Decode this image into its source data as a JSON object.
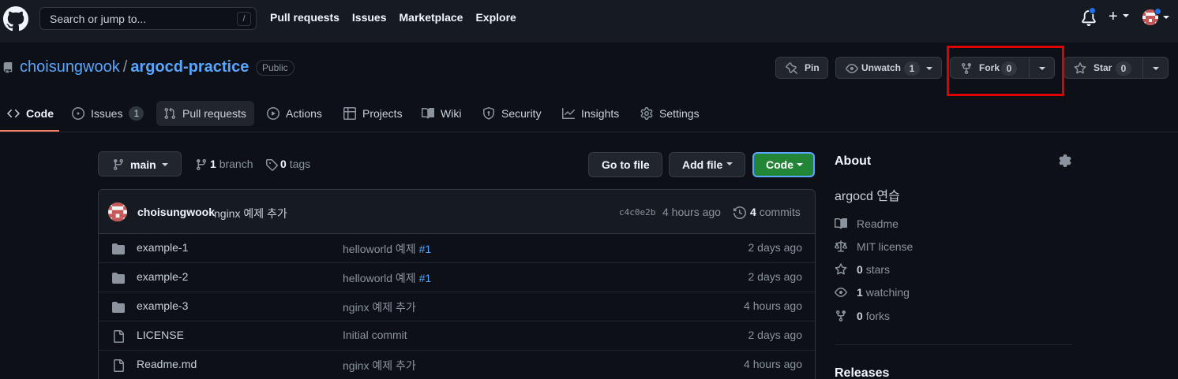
{
  "header": {
    "search_placeholder": "Search or jump to...",
    "search_shortcut": "/",
    "nav": [
      "Pull requests",
      "Issues",
      "Marketplace",
      "Explore"
    ]
  },
  "repo": {
    "owner": "choisungwook",
    "separator": "/",
    "name": "argocd-practice",
    "visibility": "Public",
    "actions": {
      "pin": "Pin",
      "unwatch": "Unwatch",
      "unwatch_count": "1",
      "fork": "Fork",
      "fork_count": "0",
      "star": "Star",
      "star_count": "0"
    }
  },
  "tabs": [
    {
      "label": "Code",
      "icon": "code-icon",
      "active": true
    },
    {
      "label": "Issues",
      "icon": "issue-icon",
      "count": "1"
    },
    {
      "label": "Pull requests",
      "icon": "pull-request-icon"
    },
    {
      "label": "Actions",
      "icon": "play-icon"
    },
    {
      "label": "Projects",
      "icon": "table-icon"
    },
    {
      "label": "Wiki",
      "icon": "book-icon"
    },
    {
      "label": "Security",
      "icon": "shield-icon"
    },
    {
      "label": "Insights",
      "icon": "graph-icon"
    },
    {
      "label": "Settings",
      "icon": "gear-icon"
    }
  ],
  "branch_bar": {
    "branch": "main",
    "branch_count": "1",
    "branch_word": "branch",
    "tag_count": "0",
    "tag_word": "tags",
    "goto_file": "Go to file",
    "add_file": "Add file",
    "code": "Code"
  },
  "latest_commit": {
    "author": "choisungwook",
    "message": "nginx 예제 추가",
    "sha": "c4c0e2b",
    "age": "4 hours ago",
    "commit_count": "4",
    "commit_word": "commits"
  },
  "files": [
    {
      "type": "folder",
      "name": "example-1",
      "message": "helloworld 예제 ",
      "ref": "#1",
      "age": "2 days ago"
    },
    {
      "type": "folder",
      "name": "example-2",
      "message": "helloworld 예제 ",
      "ref": "#1",
      "age": "2 days ago"
    },
    {
      "type": "folder",
      "name": "example-3",
      "message": "nginx 예제 추가",
      "ref": "",
      "age": "4 hours ago"
    },
    {
      "type": "file",
      "name": "LICENSE",
      "message": "Initial commit",
      "ref": "",
      "age": "2 days ago"
    },
    {
      "type": "file",
      "name": "Readme.md",
      "message": "nginx 예제 추가",
      "ref": "",
      "age": "4 hours ago"
    }
  ],
  "about": {
    "title": "About",
    "description": "argocd 연습",
    "readme": "Readme",
    "license": "MIT license",
    "stars_count": "0",
    "stars_word": "stars",
    "watching_count": "1",
    "watching_word": "watching",
    "forks_count": "0",
    "forks_word": "forks",
    "releases": "Releases"
  },
  "colors": {
    "bg": "#0d1117",
    "header_bg": "#161b22",
    "link": "#58a6ff",
    "primary_button": "#238636",
    "highlight": "#e00000"
  }
}
